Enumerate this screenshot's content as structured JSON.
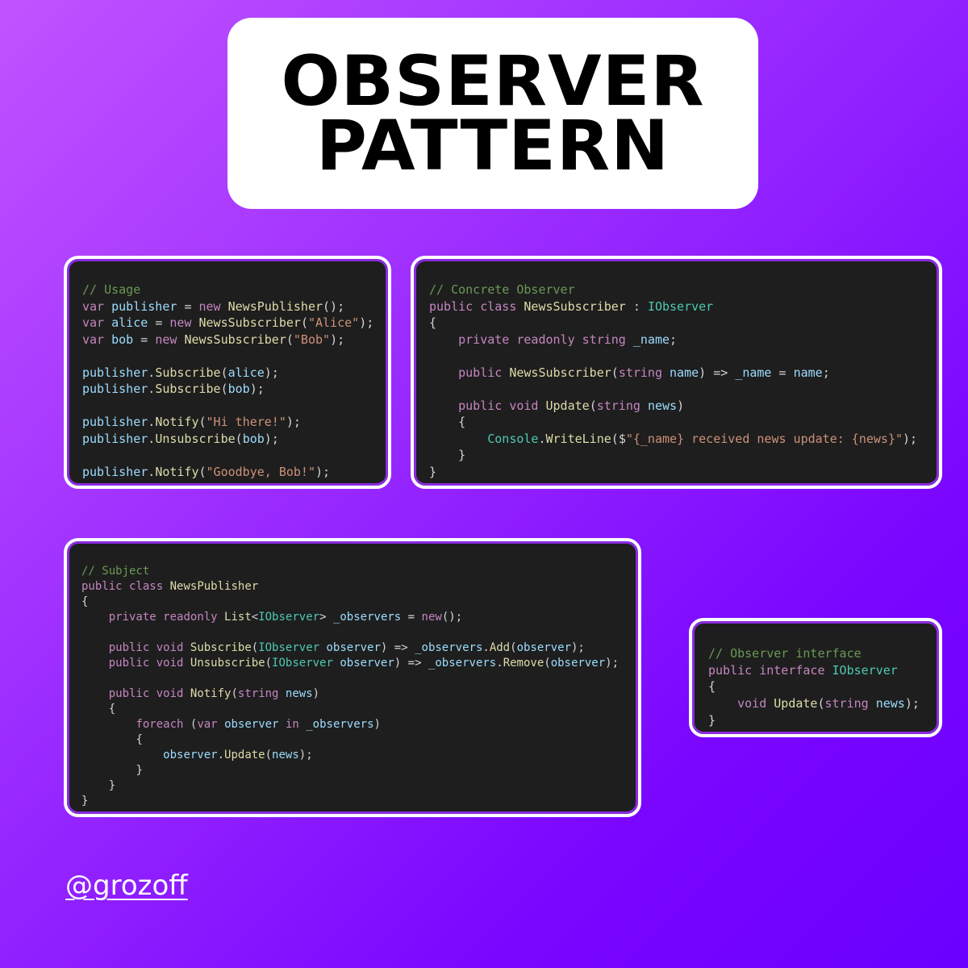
{
  "title": {
    "line1": "OBSERVER",
    "line2": "PATTERN"
  },
  "handle": "@grozoff",
  "colors": {
    "background_gradient": [
      "#c153ff",
      "#6a00ff"
    ],
    "code_background": "#1e1e1e",
    "card_border": "#ffffff",
    "card_inner_border": "#8a2be2"
  },
  "code": {
    "usage": {
      "lines": [
        "// Usage",
        "var publisher = new NewsPublisher();",
        "var alice = new NewsSubscriber(\"Alice\");",
        "var bob = new NewsSubscriber(\"Bob\");",
        "",
        "publisher.Subscribe(alice);",
        "publisher.Subscribe(bob);",
        "",
        "publisher.Notify(\"Hi there!\");",
        "publisher.Unsubscribe(bob);",
        "",
        "publisher.Notify(\"Goodbye, Bob!\");"
      ]
    },
    "concrete_observer": {
      "lines": [
        "// Concrete Observer",
        "public class NewsSubscriber : IObserver",
        "{",
        "    private readonly string _name;",
        "",
        "    public NewsSubscriber(string name) => _name = name;",
        "",
        "    public void Update(string news)",
        "    {",
        "        Console.WriteLine($\"{_name} received news update: {news}\");",
        "    }",
        "}"
      ]
    },
    "subject": {
      "lines": [
        "// Subject",
        "public class NewsPublisher",
        "{",
        "    private readonly List<IObserver> _observers = new();",
        "",
        "    public void Subscribe(IObserver observer) => _observers.Add(observer);",
        "    public void Unsubscribe(IObserver observer) => _observers.Remove(observer);",
        "",
        "    public void Notify(string news)",
        "    {",
        "        foreach (var observer in _observers)",
        "        {",
        "            observer.Update(news);",
        "        }",
        "    }",
        "}"
      ]
    },
    "observer_interface": {
      "lines": [
        "// Observer interface",
        "public interface IObserver",
        "{",
        "    void Update(string news);",
        "}"
      ]
    }
  }
}
